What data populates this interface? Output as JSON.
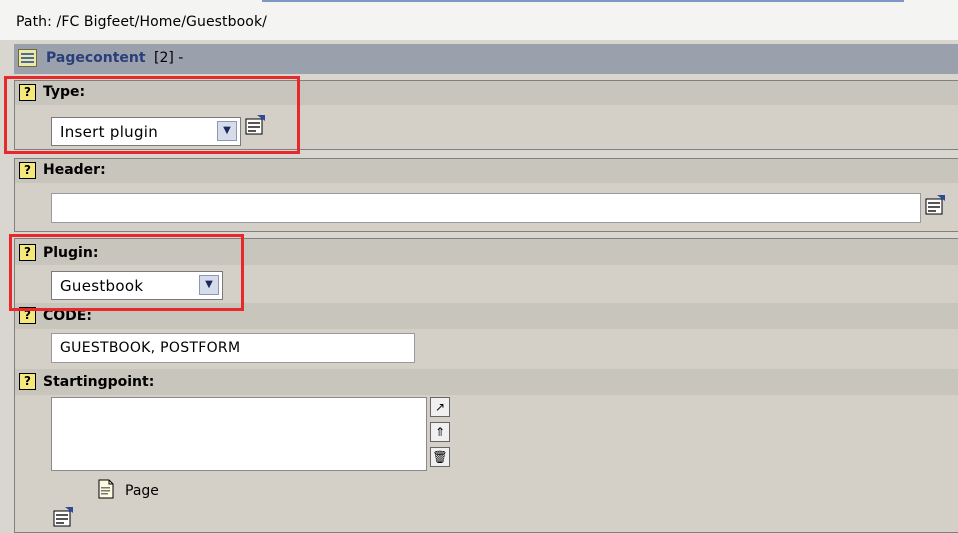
{
  "path": "Path: /FC Bigfeet/Home/Guestbook/",
  "page_content": {
    "title": "Pagecontent",
    "count": "[2] -"
  },
  "type": {
    "label": "Type:",
    "value": "Insert plugin"
  },
  "header": {
    "label": "Header:",
    "value": ""
  },
  "plugin": {
    "label": "Plugin:",
    "value": "Guestbook"
  },
  "code": {
    "label": "CODE:",
    "value": "GUESTBOOK, POSTFORM"
  },
  "startingpoint": {
    "label": "Startingpoint:",
    "item_label": "Page"
  },
  "colors": {
    "highlight": "#e8282a",
    "header_bar": "#9aa1ad",
    "title_text": "#2a3f7a"
  },
  "icons": [
    "help-icon",
    "wizard-icon",
    "page-icon",
    "browse-icon",
    "move-top-icon",
    "delete-icon",
    "table-icon"
  ]
}
